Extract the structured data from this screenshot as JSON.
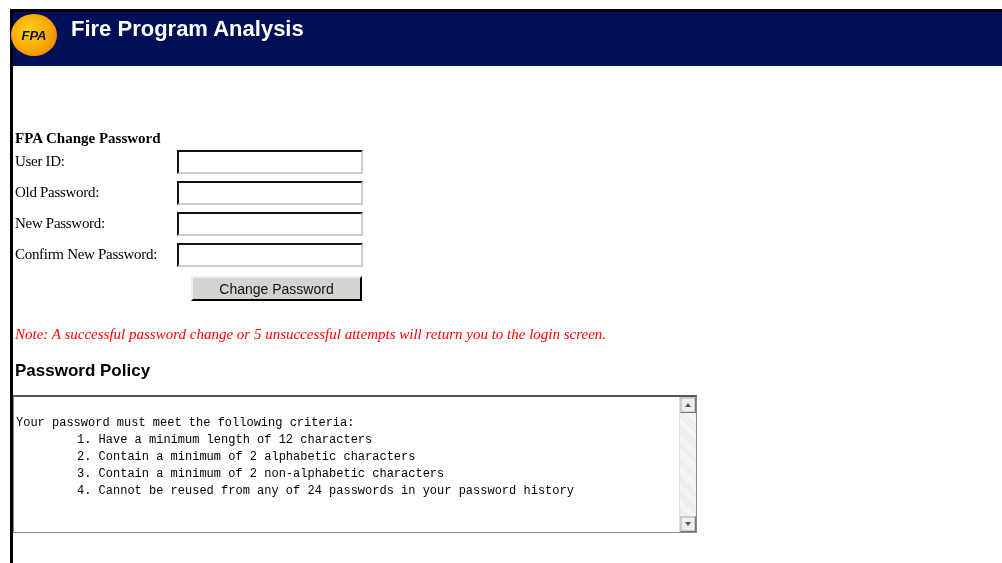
{
  "header": {
    "logo_text": "FPA",
    "title": "Fire Program Analysis"
  },
  "form": {
    "title": "FPA Change Password",
    "fields": [
      {
        "label": "User ID:"
      },
      {
        "label": "Old Password:"
      },
      {
        "label": "New Password:"
      },
      {
        "label": "Confirm New Password:"
      }
    ],
    "button": "Change Password"
  },
  "note": "Note: A successful password change or 5 unsuccessful attempts will return you to the login screen.",
  "policy": {
    "heading": "Password Policy",
    "intro": "Your password must meet the following criteria:",
    "items": [
      "1. Have a minimum length of 12 characters",
      "2. Contain a minimum of 2 alphabetic characters",
      "3. Contain a minimum of 2 non-alphabetic characters",
      "4. Cannot be reused from any of 24 passwords in your password history"
    ]
  }
}
